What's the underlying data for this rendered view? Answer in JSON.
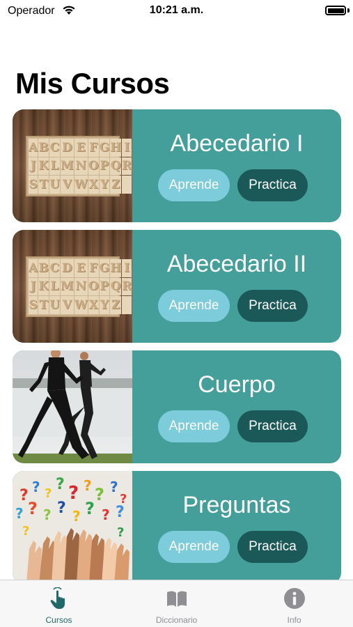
{
  "status_bar": {
    "carrier": "Operador",
    "time": "10:21 a.m."
  },
  "header": {
    "title": "Mis Cursos"
  },
  "alphabet_tiles": [
    "A",
    "B",
    "C",
    "D",
    "E",
    "F",
    "G",
    "H",
    "I",
    "J",
    "K",
    "L",
    "M",
    "N",
    "O",
    "P",
    "Q",
    "R",
    "S",
    "T",
    "U",
    "V",
    "W",
    "X",
    "Y",
    "Z",
    ""
  ],
  "courses": [
    {
      "title": "Abecedario I",
      "learn_label": "Aprende",
      "practice_label": "Practica",
      "image": "alphabet-blocks-image"
    },
    {
      "title": "Abecedario II",
      "learn_label": "Aprende",
      "practice_label": "Practica",
      "image": "alphabet-blocks-image"
    },
    {
      "title": "Cuerpo",
      "learn_label": "Aprende",
      "practice_label": "Practica",
      "image": "runners-image"
    },
    {
      "title": "Preguntas",
      "learn_label": "Aprende",
      "practice_label": "Practica",
      "image": "question-marks-hands-image"
    }
  ],
  "tabs": [
    {
      "label": "Cursos",
      "icon": "tap-hand-icon",
      "active": true
    },
    {
      "label": "Diccionario",
      "icon": "book-icon",
      "active": false
    },
    {
      "label": "Info",
      "icon": "info-icon",
      "active": false
    }
  ],
  "colors": {
    "card": "#449e9a",
    "learn_button": "#7cccdb",
    "practice_button": "#1b5858",
    "active_tab": "#1f6a69"
  }
}
